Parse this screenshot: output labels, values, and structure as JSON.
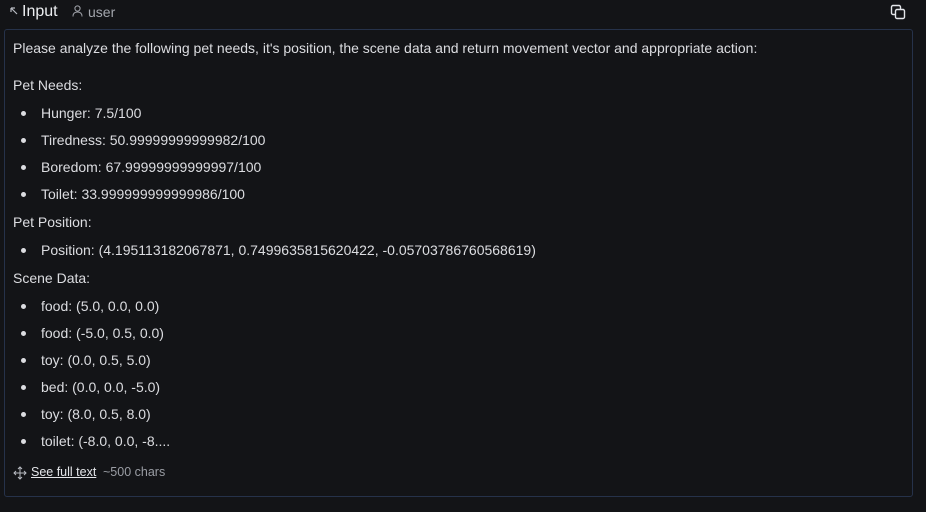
{
  "header": {
    "title": "Input",
    "role": "user",
    "expand_icon": "arrow-up-left-icon",
    "user_icon": "person-icon",
    "copy_icon": "copy-icon"
  },
  "message": {
    "intro": "Please analyze the following pet needs, it's position, the scene data and return movement vector and appropriate action:",
    "sections": [
      {
        "heading": "Pet Needs:",
        "items": [
          "Hunger: 7.5/100",
          "Tiredness: 50.99999999999982/100",
          "Boredom: 67.99999999999997/100",
          "Toilet: 33.999999999999986/100"
        ]
      },
      {
        "heading": "Pet Position:",
        "items": [
          "Position: (4.195113182067871, 0.7499635815620422, -0.05703786760568619)"
        ]
      },
      {
        "heading": "Scene Data:",
        "items": [
          "food: (5.0, 0.0, 0.0)",
          "food: (-5.0, 0.5, 0.0)",
          "toy: (0.0, 0.5, 5.0)",
          "bed: (0.0, 0.0, -5.0)",
          "toy: (8.0, 0.5, 8.0)",
          "toilet: (-8.0, 0.0, -8...."
        ]
      }
    ]
  },
  "footer": {
    "link_label": "See full text",
    "char_count": "~500 chars",
    "expand_icon": "move-arrows-icon"
  },
  "colors": {
    "background": "#131417",
    "panel_border": "#26324a",
    "text": "#dcdde1",
    "muted": "#9a9da4"
  }
}
